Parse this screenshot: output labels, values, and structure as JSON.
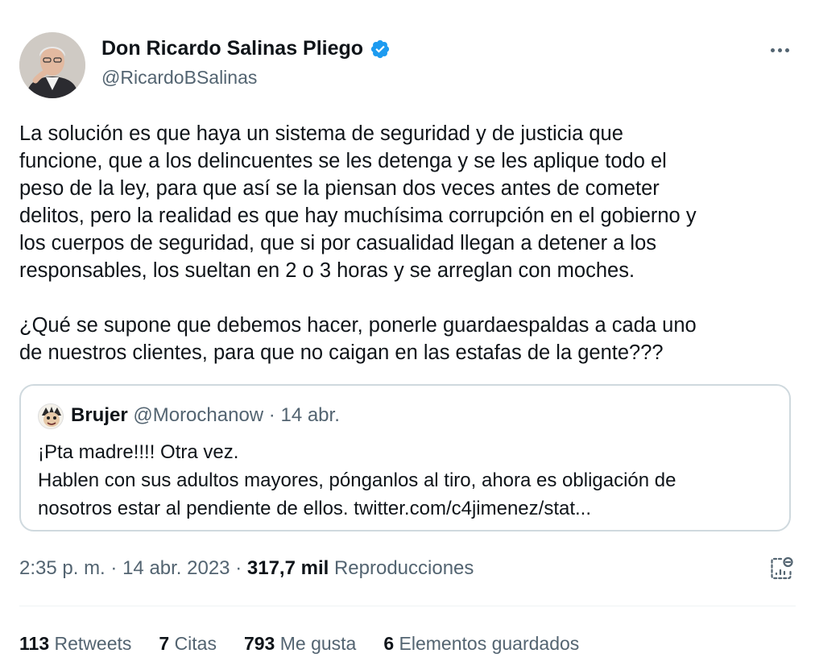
{
  "author": {
    "name": "Don Ricardo Salinas Pliego",
    "handle": "@RicardoBSalinas",
    "verified_color": "#1d9bf0"
  },
  "more_icon": "more-horizontal-icon",
  "tweet": {
    "lines": [
      "La solución es que haya un sistema de seguridad y de justicia que",
      "funcione, que a los delincuentes se les detenga y se les aplique todo el",
      "peso de la ley, para que así se la piensan dos veces antes de cometer",
      "delitos, pero la realidad es que hay muchísima corrupción en el gobierno y",
      "los cuerpos de seguridad, que si por casualidad llegan a detener a los",
      "responsables, los sueltan en 2 o 3 horas y se arreglan con moches.",
      "",
      "¿Qué se supone que debemos hacer, ponerle guardaespaldas a cada uno",
      "de nuestros clientes, para que no caigan en las estafas de la gente???"
    ]
  },
  "quote": {
    "name": "Brujer",
    "handle": "@Morochanow",
    "separator": "·",
    "date": "14 abr.",
    "lines": [
      "¡Pta madre!!!! Otra vez.",
      "Hablen con sus adultos mayores, pónganlos al tiro, ahora es obligación de",
      "nosotros estar al pendiente de ellos. twitter.com/c4jimenez/stat..."
    ]
  },
  "meta": {
    "time": "2:35 p. m.",
    "sep1": "·",
    "date": "14 abr. 2023",
    "sep2": "·",
    "views": "317,7 mil",
    "views_label": "Reproducciones"
  },
  "analytics_icon": "analytics-icon",
  "stats": [
    {
      "value": "113",
      "label": "Retweets"
    },
    {
      "value": "7",
      "label": "Citas"
    },
    {
      "value": "793",
      "label": "Me gusta"
    },
    {
      "value": "6",
      "label": "Elementos guardados"
    }
  ]
}
